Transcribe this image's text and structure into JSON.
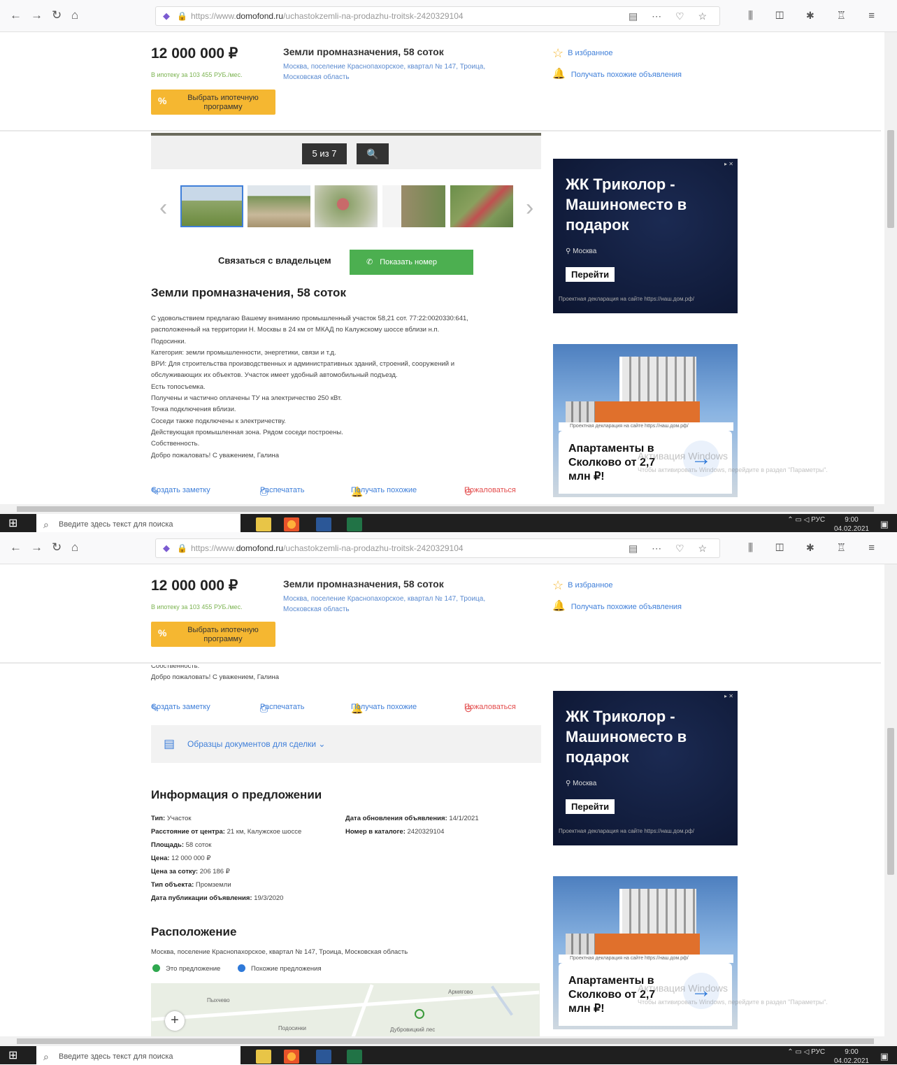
{
  "browser": {
    "url_prefix": "https://www.",
    "url_domain": "domofond.ru",
    "url_path": "/uchastokzemli-na-prodazhu-troitsk-2420329104",
    "toolbar_icons": [
      "back-icon",
      "forward-icon",
      "reload-icon",
      "home-icon"
    ]
  },
  "header": {
    "price": "12 000 000 ₽",
    "mortgage_text": "В ипотеку за 103 455 РУБ./мес.",
    "mortgage_button": "Выбрать ипотечную программу",
    "title": "Земли промназначения, 58 соток",
    "address": "Москва, поселение Краснопахорское, квартал № 147, Троица, Московская область",
    "favorite_label": "В избранное",
    "similar_label": "Получать похожие объявления"
  },
  "gallery": {
    "counter": "5 из 7",
    "prev_arrow": "‹",
    "next_arrow": "›",
    "thumb_count": 5
  },
  "contact": {
    "label": "Связаться с владельцем",
    "show_phone": "Показать номер"
  },
  "description": {
    "title": "Земли промназначения, 58 соток",
    "lines": [
      "С удовольствием предлагаю Вашему вниманию промышленный участок 58,21 сот. 77:22:0020330:641,",
      "расположенный на территории Н. Москвы в 24 км от МКАД по Калужскому шоссе вблизи н.п.",
      "Подосинки.",
      "Категория: земли промышленности, энергетики, связи и т.д.",
      "ВРИ: Для строительства производственных и административных зданий, строений, сооружений и",
      "обслуживающих их объектов. Участок имеет удобный автомобильный подъезд.",
      "Есть топосъемка.",
      "Получены и частично оплачены ТУ на электричество 250 кВт.",
      "Точка подключения вблизи.",
      "Соседи также подключены к электричеству.",
      "Действующая промышленная зона. Рядом соседи построены.",
      "Собственность.",
      "Добро пожаловать! С уважением, Галина"
    ],
    "tail_lines": [
      "Собственность.",
      "Добро пожаловать! С уважением, Галина"
    ]
  },
  "actions": {
    "note": "Создать заметку",
    "print": "Распечатать",
    "similar": "Получать похожие",
    "complain": "Пожаловаться"
  },
  "docs": {
    "label": "Образцы документов для сделки"
  },
  "info": {
    "title": "Информация о предложении",
    "left": [
      {
        "k": "Тип:",
        "v": "Участок"
      },
      {
        "k": "Расстояние от центра:",
        "v": "21 км, Калужское шоссе"
      },
      {
        "k": "Площадь:",
        "v": "58 соток"
      },
      {
        "k": "Цена:",
        "v": "12 000 000 ₽"
      },
      {
        "k": "Цена за сотку:",
        "v": "206 186 ₽"
      },
      {
        "k": "Тип объекта:",
        "v": "Промземли"
      },
      {
        "k": "Дата публикации объявления:",
        "v": "19/3/2020"
      }
    ],
    "right": [
      {
        "k": "Дата обновления объявления:",
        "v": "14/1/2021"
      },
      {
        "k": "Номер в каталоге:",
        "v": "2420329104"
      }
    ]
  },
  "location": {
    "title": "Расположение",
    "address": "Москва, поселение Краснопахорское, квартал № 147, Троица, Московская область",
    "legend_this": "Это предложение",
    "legend_similar": "Похожие предложения",
    "map_labels": [
      "Пыхчево",
      "Подосинки",
      "Дубровицкий лес",
      "Армягово"
    ],
    "zoom_in": "+"
  },
  "ads": {
    "ad1_title": "ЖК Триколор - Машиноместо в подарок",
    "ad1_location": "Москва",
    "ad1_button": "Перейти",
    "ad1_disclaimer": "Проектная декларация на сайте https://наш.дом.рф/",
    "ad2_strip": "Проектная декларация на сайте https://наш.дом.рф/",
    "ad2_title": "Апартаменты в Сколково от 2,7 млн ₽!"
  },
  "watermark": {
    "title": "Активация Windows",
    "sub": "Чтобы активировать Windows, перейдите в раздел \"Параметры\"."
  },
  "taskbar": {
    "search_placeholder": "Введите здесь текст для поиска",
    "lang": "РУС",
    "time": "9:00",
    "date": "04.02.2021"
  },
  "colors": {
    "price_accent": "#f5b731",
    "link": "#3f7fd9",
    "green": "#4caf50",
    "this_offer": "#2fa84f",
    "similar_offer": "#2e79d9"
  }
}
